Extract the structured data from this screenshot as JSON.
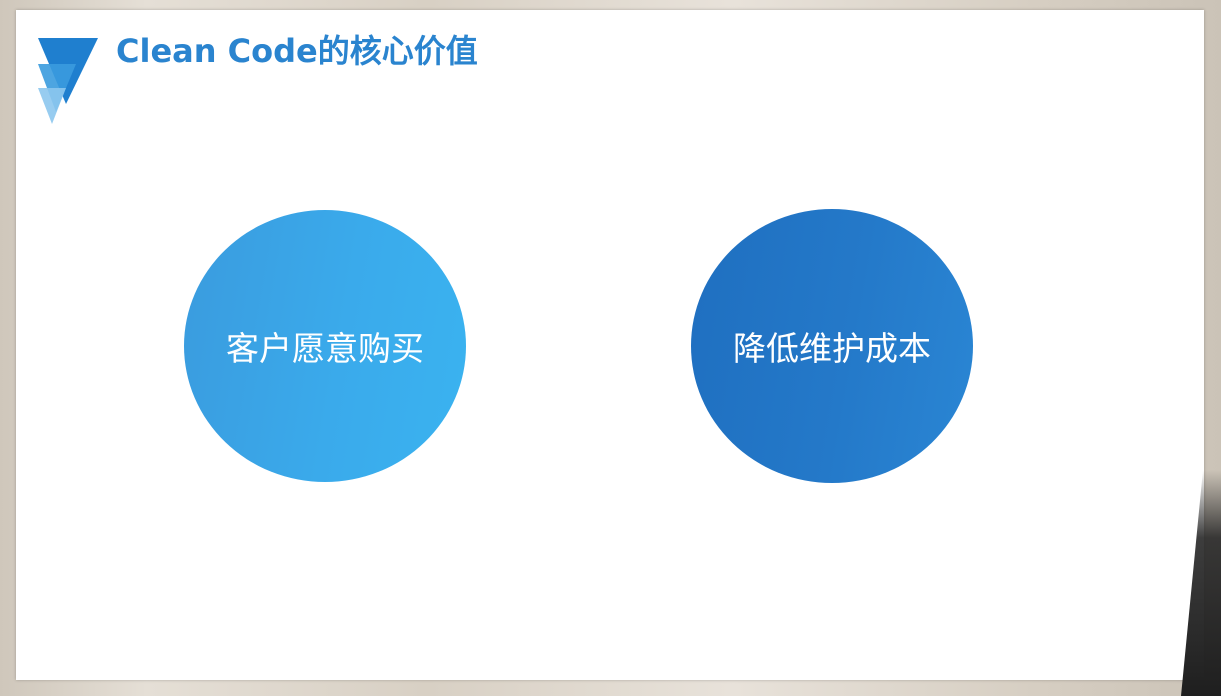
{
  "slide": {
    "title": "Clean Code的核心价值",
    "logo_icon": "blue-triangle-logo-icon",
    "circles": [
      {
        "label": "客户愿意购买",
        "color": "#3aaaeb"
      },
      {
        "label": "降低维护成本",
        "color": "#2479c9"
      }
    ]
  },
  "colors": {
    "title": "#2a84cf",
    "accent_light": "#3aaaeb",
    "accent_dark": "#2479c9"
  }
}
